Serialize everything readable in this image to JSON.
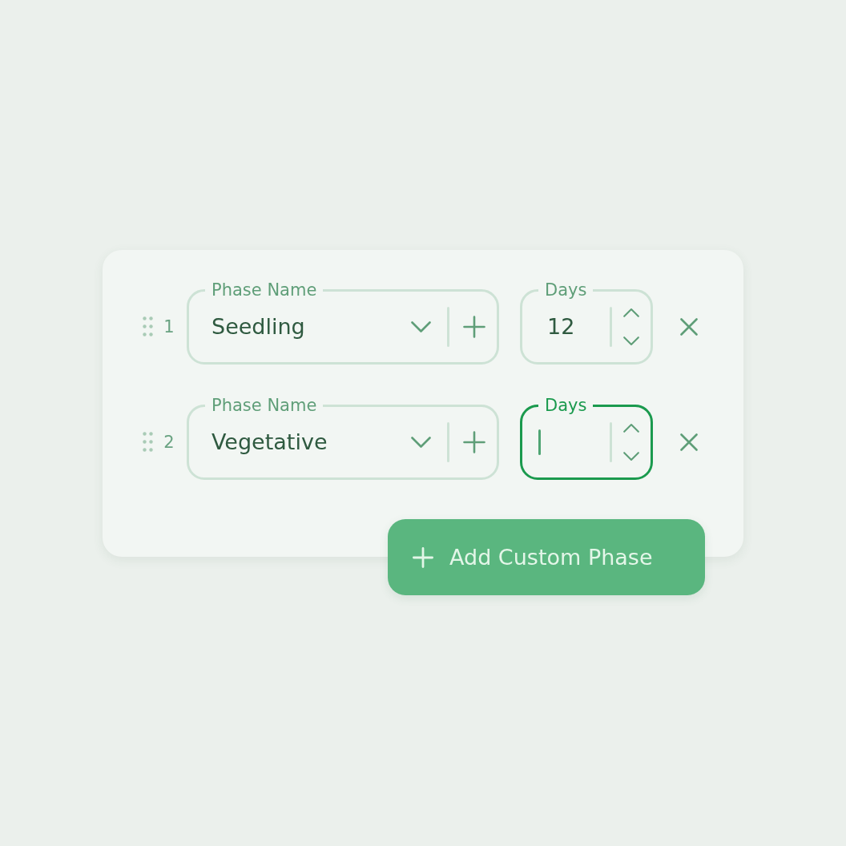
{
  "phases": [
    {
      "number": "1",
      "name_field": {
        "label": "Phase Name",
        "value": "Seedling"
      },
      "days_field": {
        "label": "Days",
        "value": "12",
        "focused": false
      }
    },
    {
      "number": "2",
      "name_field": {
        "label": "Phase Name",
        "value": "Vegetative"
      },
      "days_field": {
        "label": "Days",
        "focused": true
      }
    }
  ],
  "add_button": {
    "label": "Add Custom Phase"
  }
}
